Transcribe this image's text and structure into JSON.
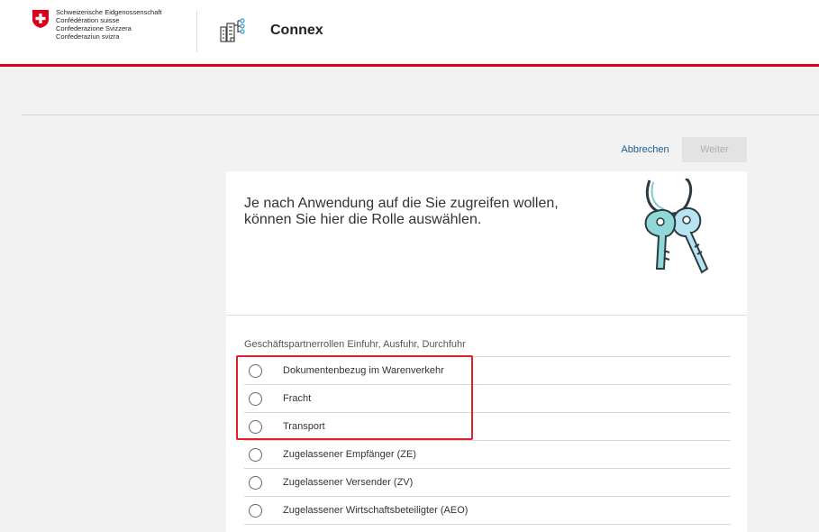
{
  "header": {
    "gov_lines": [
      "Schweizerische Eidgenossenschaft",
      "Confédération suisse",
      "Confederazione Svizzera",
      "Confederaziun svizra"
    ],
    "app_title": "Connex",
    "accent_color": "#dc0018"
  },
  "actions": {
    "cancel_label": "Abbrechen",
    "next_label": "Weiter"
  },
  "card": {
    "intro_text": "Je nach Anwendung auf die Sie zugreifen wollen, können Sie hier die Rolle auswählen.",
    "section_title": "Geschäftspartnerrollen Einfuhr, Ausfuhr, Durchfuhr",
    "roles": [
      "Dokumentenbezug im Warenverkehr",
      "Fracht",
      "Transport",
      "Zugelassener Empfänger (ZE)",
      "Zugelassener Versender (ZV)",
      "Zugelassener Wirtschaftsbeteiligter (AEO)"
    ]
  },
  "icons": {
    "crest": "swiss-cross-icon",
    "app": "connex-app-icon",
    "illustration": "keys-icon",
    "radio": "radio-unchecked-icon"
  },
  "highlight_color": "#e0202c"
}
